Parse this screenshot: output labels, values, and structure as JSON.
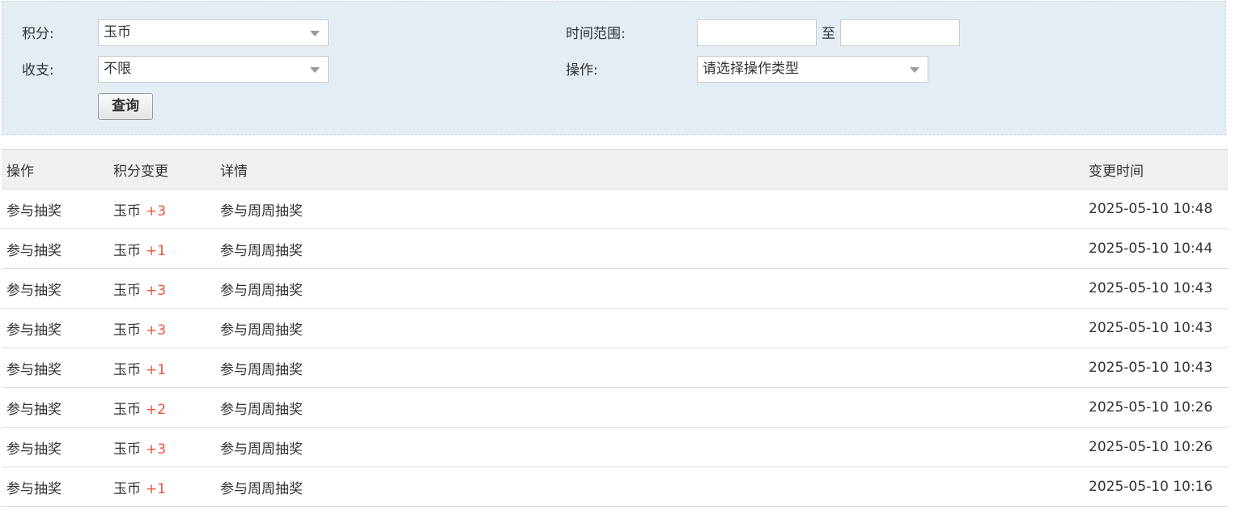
{
  "filters": {
    "points_label": "积分:",
    "points_value": "玉币",
    "income_label": "收支:",
    "income_value": "不限",
    "time_range_label": "时间范围:",
    "time_separator": "至",
    "time_start": "",
    "time_end": "",
    "operation_label": "操作:",
    "operation_placeholder": "请选择操作类型",
    "query_button": "查询"
  },
  "table": {
    "headers": [
      "操作",
      "积分变更",
      "详情",
      "变更时间"
    ],
    "rows": [
      {
        "op": "参与抽奖",
        "currency": "玉币",
        "delta": "+3",
        "detail": "参与周周抽奖",
        "time": "2025-05-10 10:48"
      },
      {
        "op": "参与抽奖",
        "currency": "玉币",
        "delta": "+1",
        "detail": "参与周周抽奖",
        "time": "2025-05-10 10:44"
      },
      {
        "op": "参与抽奖",
        "currency": "玉币",
        "delta": "+3",
        "detail": "参与周周抽奖",
        "time": "2025-05-10 10:43"
      },
      {
        "op": "参与抽奖",
        "currency": "玉币",
        "delta": "+3",
        "detail": "参与周周抽奖",
        "time": "2025-05-10 10:43"
      },
      {
        "op": "参与抽奖",
        "currency": "玉币",
        "delta": "+1",
        "detail": "参与周周抽奖",
        "time": "2025-05-10 10:43"
      },
      {
        "op": "参与抽奖",
        "currency": "玉币",
        "delta": "+2",
        "detail": "参与周周抽奖",
        "time": "2025-05-10 10:26"
      },
      {
        "op": "参与抽奖",
        "currency": "玉币",
        "delta": "+3",
        "detail": "参与周周抽奖",
        "time": "2025-05-10 10:26"
      },
      {
        "op": "参与抽奖",
        "currency": "玉币",
        "delta": "+1",
        "detail": "参与周周抽奖",
        "time": "2025-05-10 10:16"
      }
    ]
  },
  "colors": {
    "delta_positive": "#e8553c",
    "filter_bg": "#e5edf4"
  }
}
